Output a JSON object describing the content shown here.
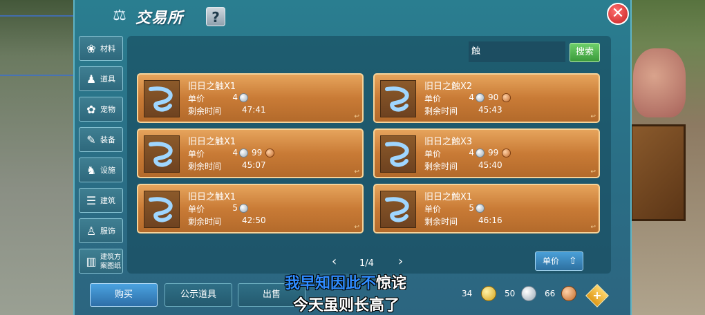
{
  "header": {
    "title": "交易所",
    "help_label": "?",
    "close_label": "✕"
  },
  "sidebar": {
    "items": [
      {
        "label": "材料",
        "icon": "materials-icon"
      },
      {
        "label": "道具",
        "icon": "props-icon"
      },
      {
        "label": "宠物",
        "icon": "paw-icon"
      },
      {
        "label": "装备",
        "icon": "equipment-icon"
      },
      {
        "label": "设施",
        "icon": "facility-icon"
      },
      {
        "label": "建筑",
        "icon": "building-icon"
      },
      {
        "label": "服饰",
        "icon": "clothing-icon"
      },
      {
        "label": "建筑方案图纸",
        "icon": "blueprint-icon"
      }
    ]
  },
  "search": {
    "value": "触",
    "button_label": "搜索"
  },
  "labels": {
    "unit_price": "单价",
    "remaining_time": "剩余时间"
  },
  "listings": [
    {
      "name": "旧日之触X1",
      "silver": "4",
      "copper": "",
      "time": "47:41"
    },
    {
      "name": "旧日之触X2",
      "silver": "4",
      "copper": "90",
      "time": "45:43"
    },
    {
      "name": "旧日之触X1",
      "silver": "4",
      "copper": "99",
      "time": "45:07"
    },
    {
      "name": "旧日之触X3",
      "silver": "4",
      "copper": "99",
      "time": "45:40"
    },
    {
      "name": "旧日之触X1",
      "silver": "5",
      "copper": "",
      "time": "42:50"
    },
    {
      "name": "旧日之触X1",
      "silver": "5",
      "copper": "",
      "time": "46:16"
    }
  ],
  "pager": {
    "prev": "‹",
    "page_text": "1/4",
    "next": "›"
  },
  "sort_button": {
    "label": "单价",
    "arrow": "⇧"
  },
  "bottom_tabs": {
    "buy": "购买",
    "public": "公示道具",
    "sell": "出售"
  },
  "currency": {
    "gold": "34",
    "silver": "50",
    "copper": "66",
    "add": "+"
  },
  "subtitles": {
    "line1_highlight": "我早知因此不",
    "line1_rest": "惊诧",
    "line2": "今天虽则长高了"
  },
  "colors": {
    "panel": "#2a7e90",
    "card": "#c97b36",
    "active_tab": "#4aa2e0",
    "search_button": "#3a9a3a",
    "subtitle_highlight": "#2f8cff"
  }
}
